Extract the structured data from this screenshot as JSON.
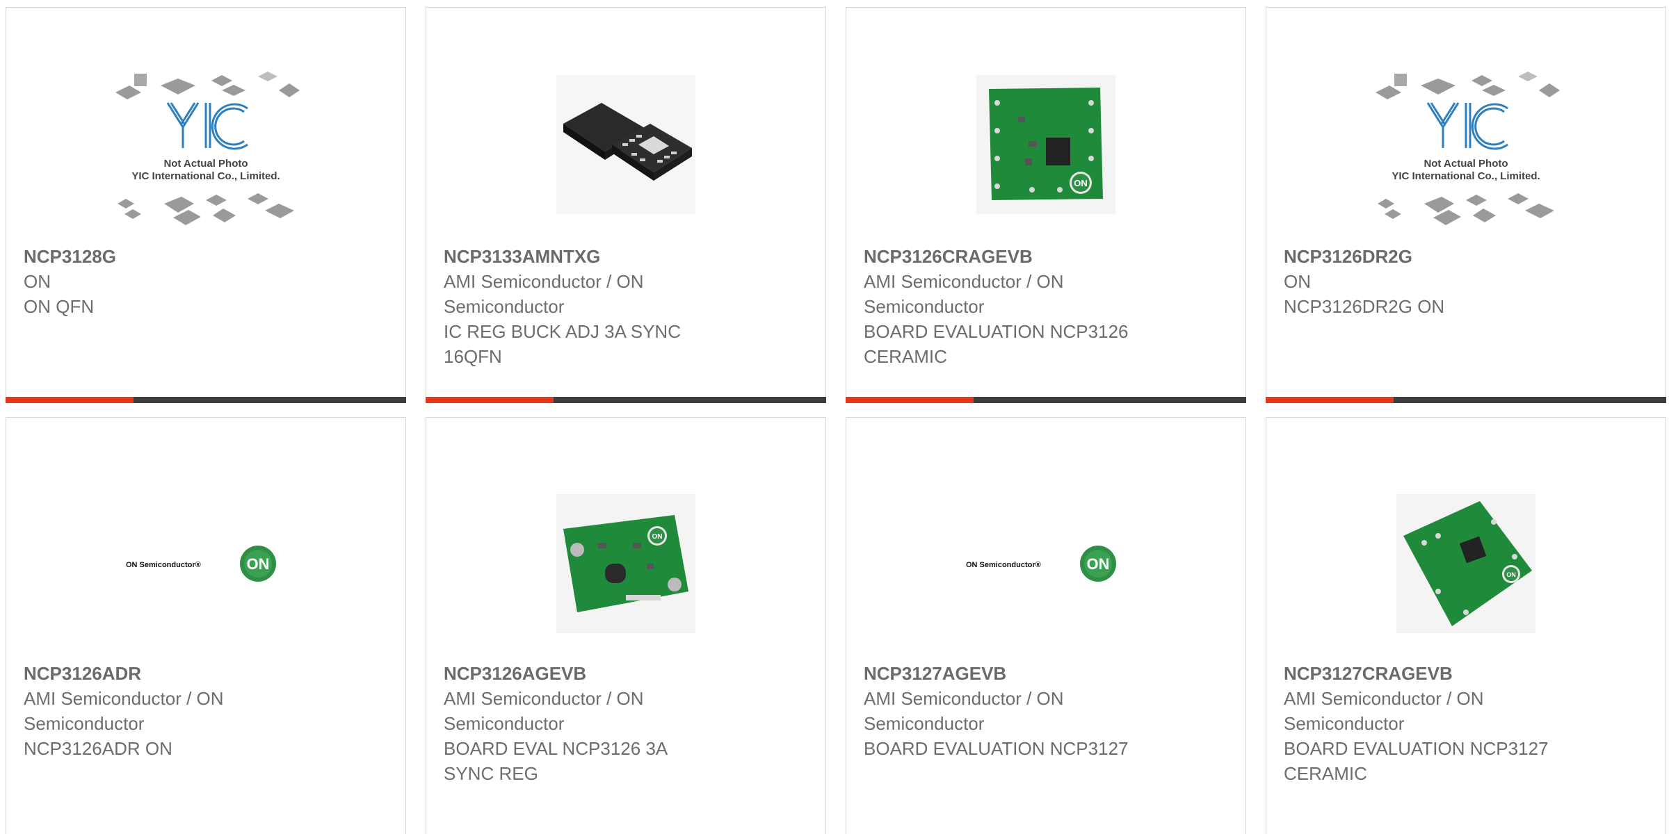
{
  "colors": {
    "accent": "#e0391b",
    "bar": "#3d3d3d",
    "text": "#6d6d6d",
    "border": "#d6d6d6",
    "pcb": "#1f8a3a"
  },
  "products": [
    {
      "part": "NCP3128G",
      "manufacturer": "ON",
      "description": "ON QFN",
      "image": "placeholder-not-actual-photo",
      "placeholder_line1": "Not Actual Photo",
      "placeholder_line2": "YIC International Co., Limited.",
      "logo_text": "YIC"
    },
    {
      "part": "NCP3133AMNTXG",
      "manufacturer": "AMI Semiconductor / ON Semiconductor",
      "description": "IC REG BUCK ADJ 3A SYNC 16QFN",
      "image": "qfn-chip-photo"
    },
    {
      "part": "NCP3126CRAGEVB",
      "manufacturer": "AMI Semiconductor / ON Semiconductor",
      "description": "BOARD EVALUATION NCP3126 CERAMIC",
      "image": "evaluation-board-photo"
    },
    {
      "part": "NCP3126DR2G",
      "manufacturer": "ON",
      "description": "NCP3126DR2G ON",
      "image": "placeholder-not-actual-photo",
      "placeholder_line1": "Not Actual Photo",
      "placeholder_line2": "YIC International Co., Limited.",
      "logo_text": "YIC"
    },
    {
      "part": "NCP3126ADR",
      "manufacturer": "AMI Semiconductor / ON Semiconductor",
      "description": "NCP3126ADR ON",
      "image": "on-semiconductor-logo",
      "brand_text": "ON Semiconductor®",
      "badge_text": "ON"
    },
    {
      "part": "NCP3126AGEVB",
      "manufacturer": "AMI Semiconductor / ON Semiconductor",
      "description": "BOARD EVAL NCP3126 3A SYNC REG",
      "image": "evaluation-board-photo"
    },
    {
      "part": "NCP3127AGEVB",
      "manufacturer": "AMI Semiconductor / ON Semiconductor",
      "description": "BOARD EVALUATION NCP3127",
      "image": "on-semiconductor-logo",
      "brand_text": "ON Semiconductor®",
      "badge_text": "ON"
    },
    {
      "part": "NCP3127CRAGEVB",
      "manufacturer": "AMI Semiconductor / ON Semiconductor",
      "description": "BOARD EVALUATION NCP3127 CERAMIC",
      "image": "evaluation-board-photo"
    }
  ]
}
